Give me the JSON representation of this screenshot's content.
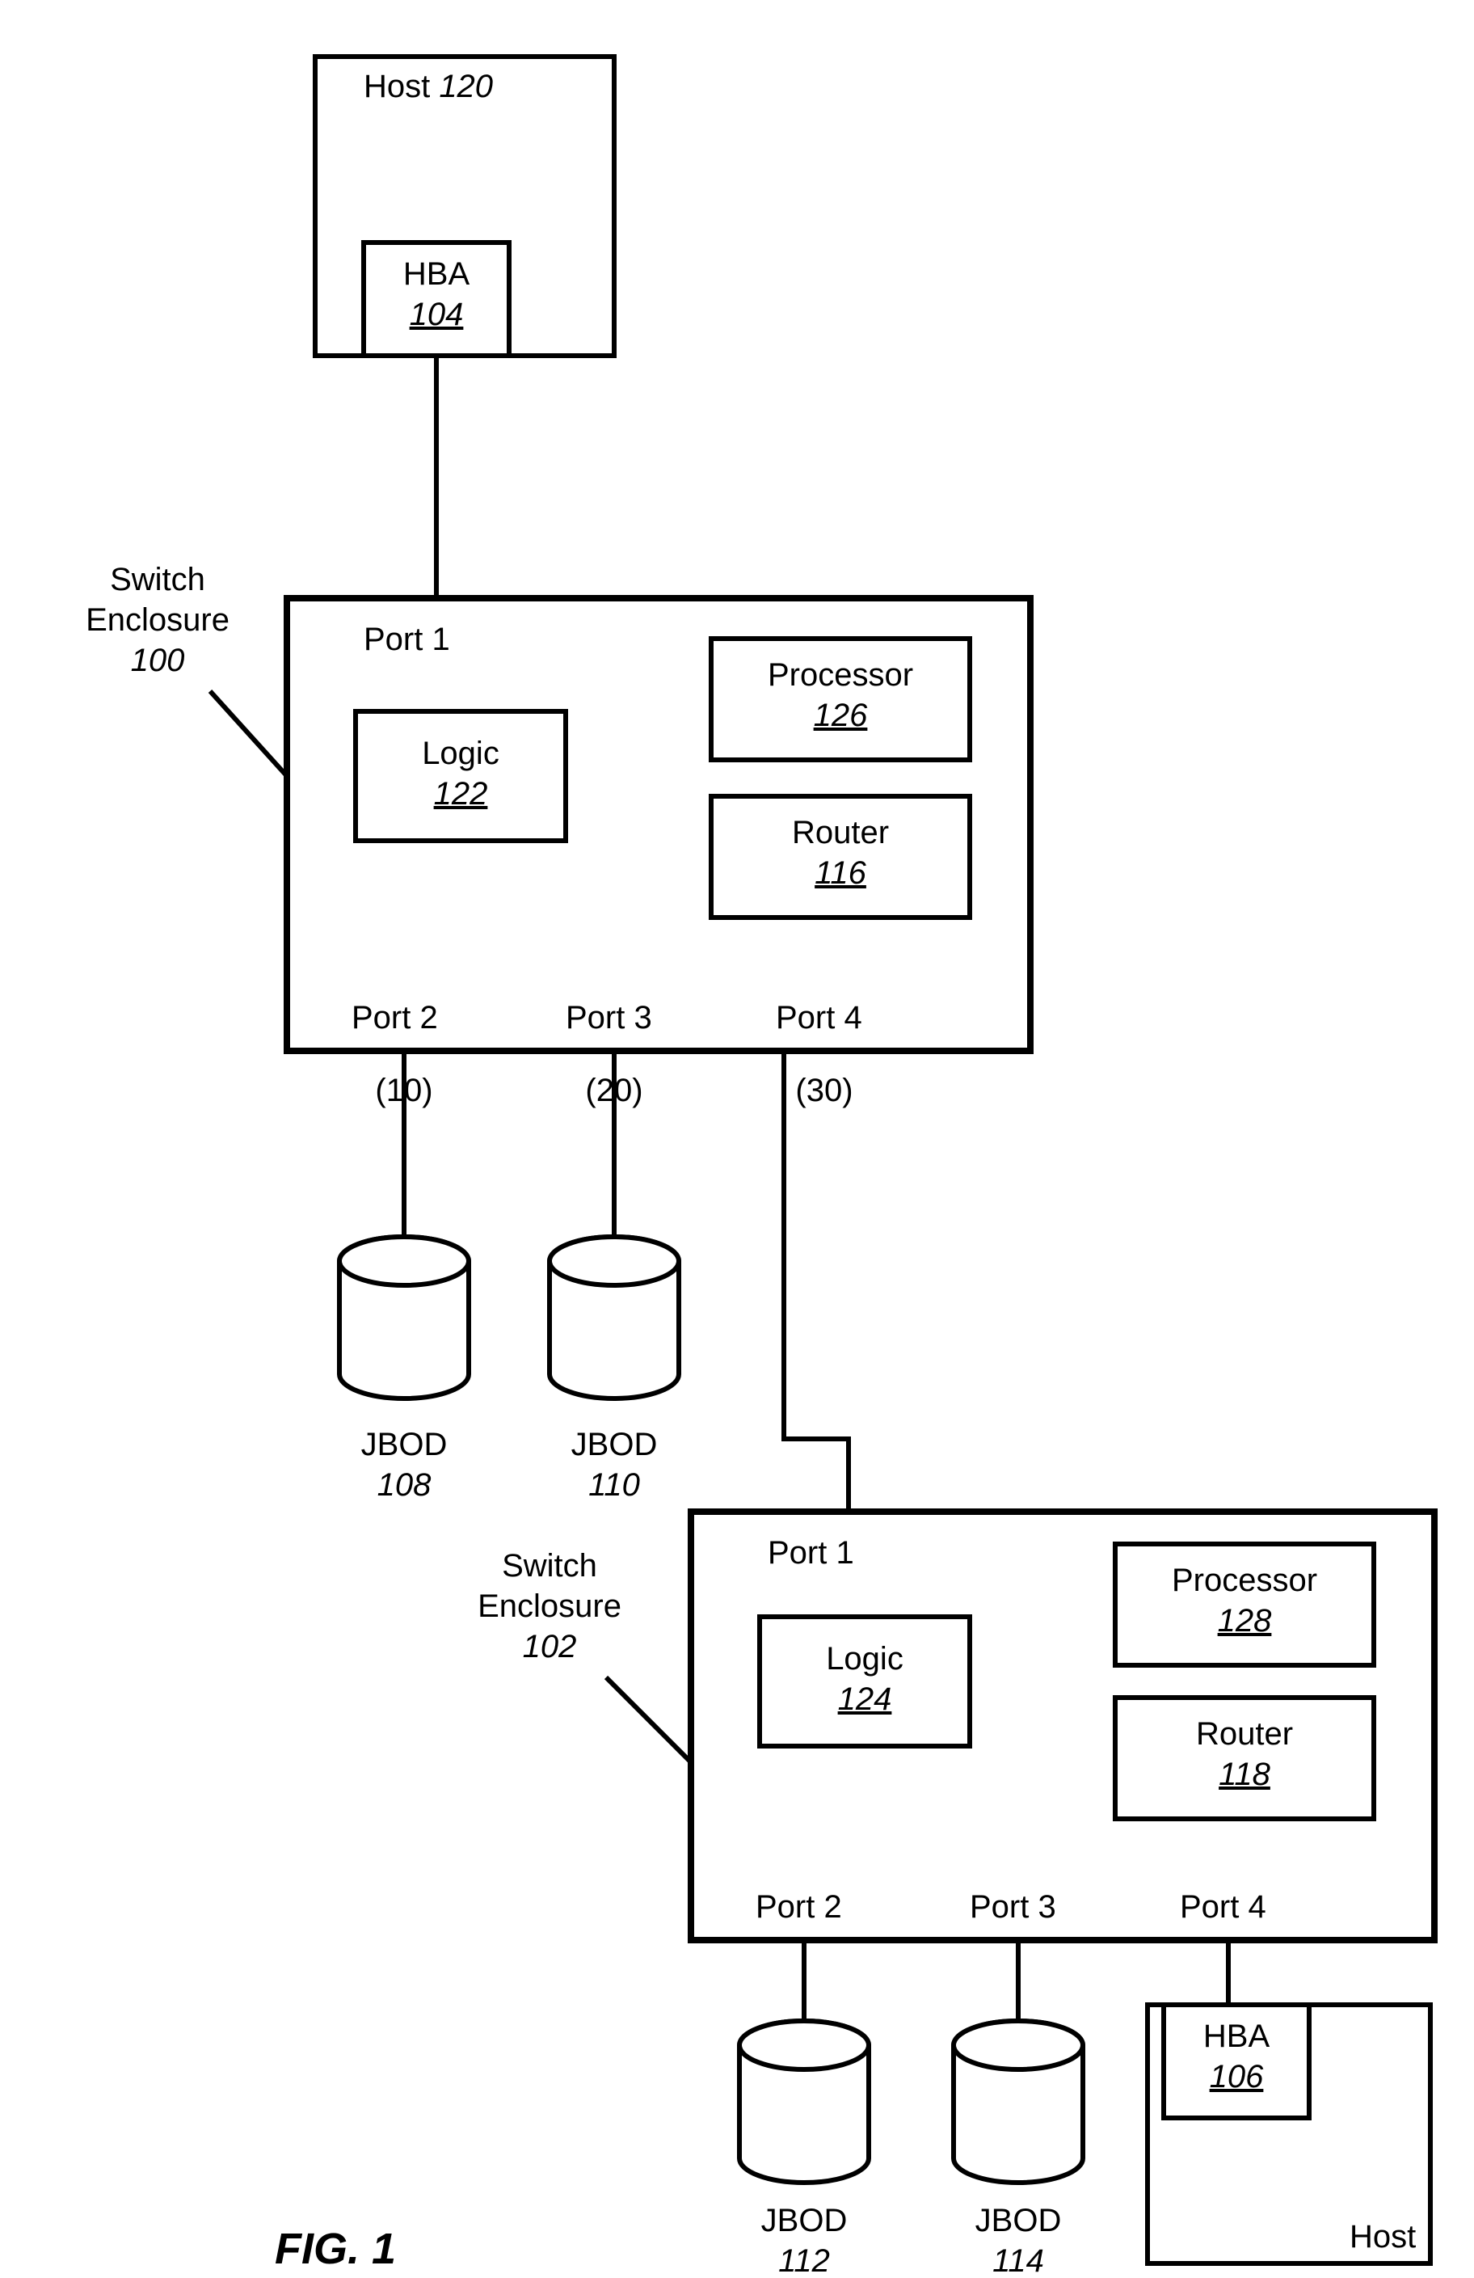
{
  "figure_label": "FIG. 1",
  "host1": {
    "title": "Host",
    "ref": "120"
  },
  "hba1": {
    "title": "HBA",
    "ref": "104"
  },
  "enclosure1_label": {
    "l1": "Switch",
    "l2": "Enclosure",
    "ref": "100"
  },
  "enclosure1": {
    "port_top": "Port 1",
    "logic": {
      "title": "Logic",
      "ref": "122"
    },
    "processor": {
      "title": "Processor",
      "ref": "126"
    },
    "router": {
      "title": "Router",
      "ref": "116"
    },
    "port2": "Port 2",
    "port3": "Port 3",
    "port4": "Port 4",
    "p2_num": "(10)",
    "p3_num": "(20)",
    "p4_num": "(30)"
  },
  "jbod1": {
    "title": "JBOD",
    "ref": "108"
  },
  "jbod2": {
    "title": "JBOD",
    "ref": "110"
  },
  "enclosure2_label": {
    "l1": "Switch",
    "l2": "Enclosure",
    "ref": "102"
  },
  "enclosure2": {
    "port_top": "Port 1",
    "logic": {
      "title": "Logic",
      "ref": "124"
    },
    "processor": {
      "title": "Processor",
      "ref": "128"
    },
    "router": {
      "title": "Router",
      "ref": "118"
    },
    "port2": "Port 2",
    "port3": "Port 3",
    "port4": "Port 4"
  },
  "jbod3": {
    "title": "JBOD",
    "ref": "112"
  },
  "jbod4": {
    "title": "JBOD",
    "ref": "114"
  },
  "hba2": {
    "title": "HBA",
    "ref": "106"
  },
  "host2_label": "Host"
}
